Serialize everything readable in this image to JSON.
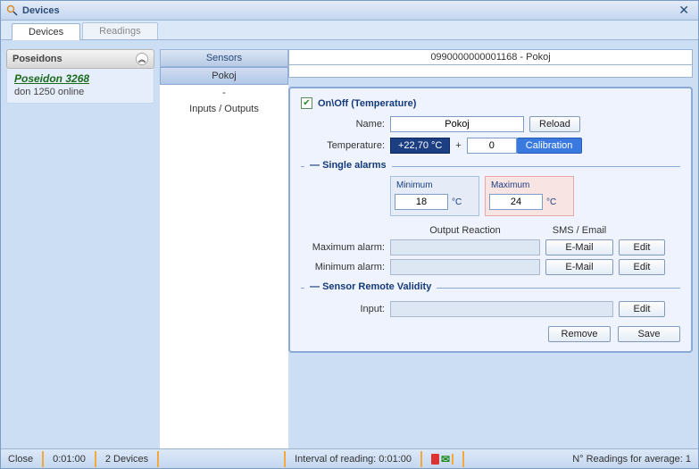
{
  "window": {
    "title": "Devices"
  },
  "tabs": {
    "devices": "Devices",
    "readings": "Readings"
  },
  "tree": {
    "group": "Poseidons",
    "node_title": "Poseidon 3268",
    "node_sub": "don 1250 online"
  },
  "mid": {
    "header": "Sensors",
    "selected": "Pokoj",
    "dash": "-",
    "io": "Inputs / Outputs"
  },
  "device_bar": "0990000000001168 - Pokoj",
  "form": {
    "onoff": "On\\Off (Temperature)",
    "name_label": "Name:",
    "name_value": "Pokoj",
    "reload": "Reload",
    "temp_label": "Temperature:",
    "temp_value": "+22,70 °C",
    "plus": "+",
    "offset_value": "0",
    "calibration": "Calibration"
  },
  "single_alarms": {
    "legend": "Single alarms",
    "min_label": "Minimum",
    "min_value": "18",
    "max_label": "Maximum",
    "max_value": "24",
    "unit": "°C",
    "output_reaction": "Output Reaction",
    "sms_email": "SMS / Email",
    "max_alarm": "Maximum alarm:",
    "min_alarm": "Minimum alarm:",
    "email_btn": "E-Mail",
    "edit_btn": "Edit"
  },
  "remote": {
    "legend": "Sensor Remote Validity",
    "input_label": "Input:",
    "edit": "Edit"
  },
  "footer": {
    "remove": "Remove",
    "save": "Save"
  },
  "status": {
    "close": "Close",
    "time1": "0:01:00",
    "devices": "2 Devices",
    "interval": "Interval of reading: 0:01:00",
    "avg": "N° Readings for average: 1"
  }
}
